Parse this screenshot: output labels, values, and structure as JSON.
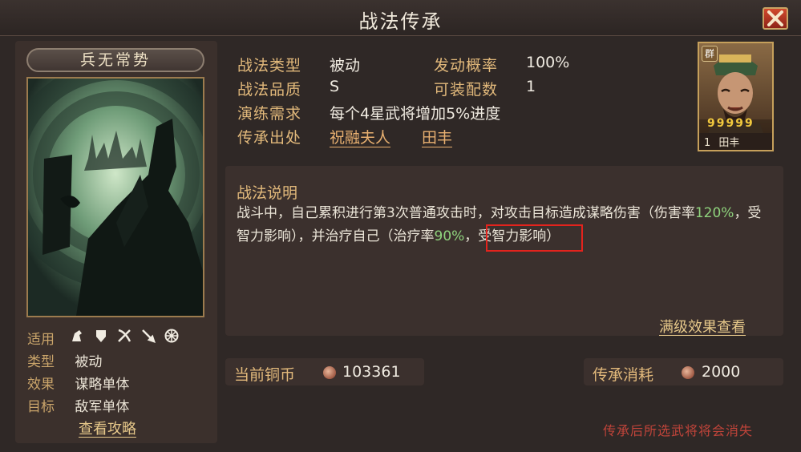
{
  "window": {
    "title": "战法传承",
    "close_icon": "close-icon"
  },
  "skill": {
    "name": "兵无常势",
    "attributes": [
      {
        "key": "适用",
        "value": ""
      },
      {
        "key": "类型",
        "value": "被动"
      },
      {
        "key": "效果",
        "value": "谋略单体"
      },
      {
        "key": "目标",
        "value": "敌军单体"
      }
    ],
    "applicable_icons": [
      "cavalry-icon",
      "shield-icon",
      "bow-icon",
      "spear-icon",
      "siege-icon"
    ],
    "guide_link": "查看攻略"
  },
  "info": {
    "type_label": "战法类型",
    "type_value": "被动",
    "rate_label": "发动概率",
    "rate_value": "100%",
    "quality_label": "战法品质",
    "quality_value": "S",
    "equip_label": "可装配数",
    "equip_value": "1",
    "req_label": "演练需求",
    "req_value": "每个4星武将增加5%进度",
    "source_label": "传承出处",
    "source_links": [
      "祝融夫人",
      "田丰"
    ]
  },
  "general": {
    "faction": "群",
    "stars": "99999",
    "level": "1",
    "name": "田丰"
  },
  "description": {
    "title": "战法说明",
    "part1": "战斗中，自己累积进行第3次普通攻击时，对攻击目标造成谋略伤害（伤害率",
    "dmg_rate": "120%",
    "part2": "，受智力影响），",
    "highlight": "并治疗自己",
    "part3": "（治疗率",
    "heal_rate": "90%",
    "part4": "，受智力影响）",
    "full_effect_link": "满级效果查看"
  },
  "currency": {
    "current_label": "当前铜币",
    "current_value": "103361",
    "cost_label": "传承消耗",
    "cost_value": "2000"
  },
  "warning": "传承后所选武将将会消失",
  "colors": {
    "label_gold": "#e2b97b",
    "highlight_red": "#e3231d",
    "rate_green": "#8fd37d"
  }
}
